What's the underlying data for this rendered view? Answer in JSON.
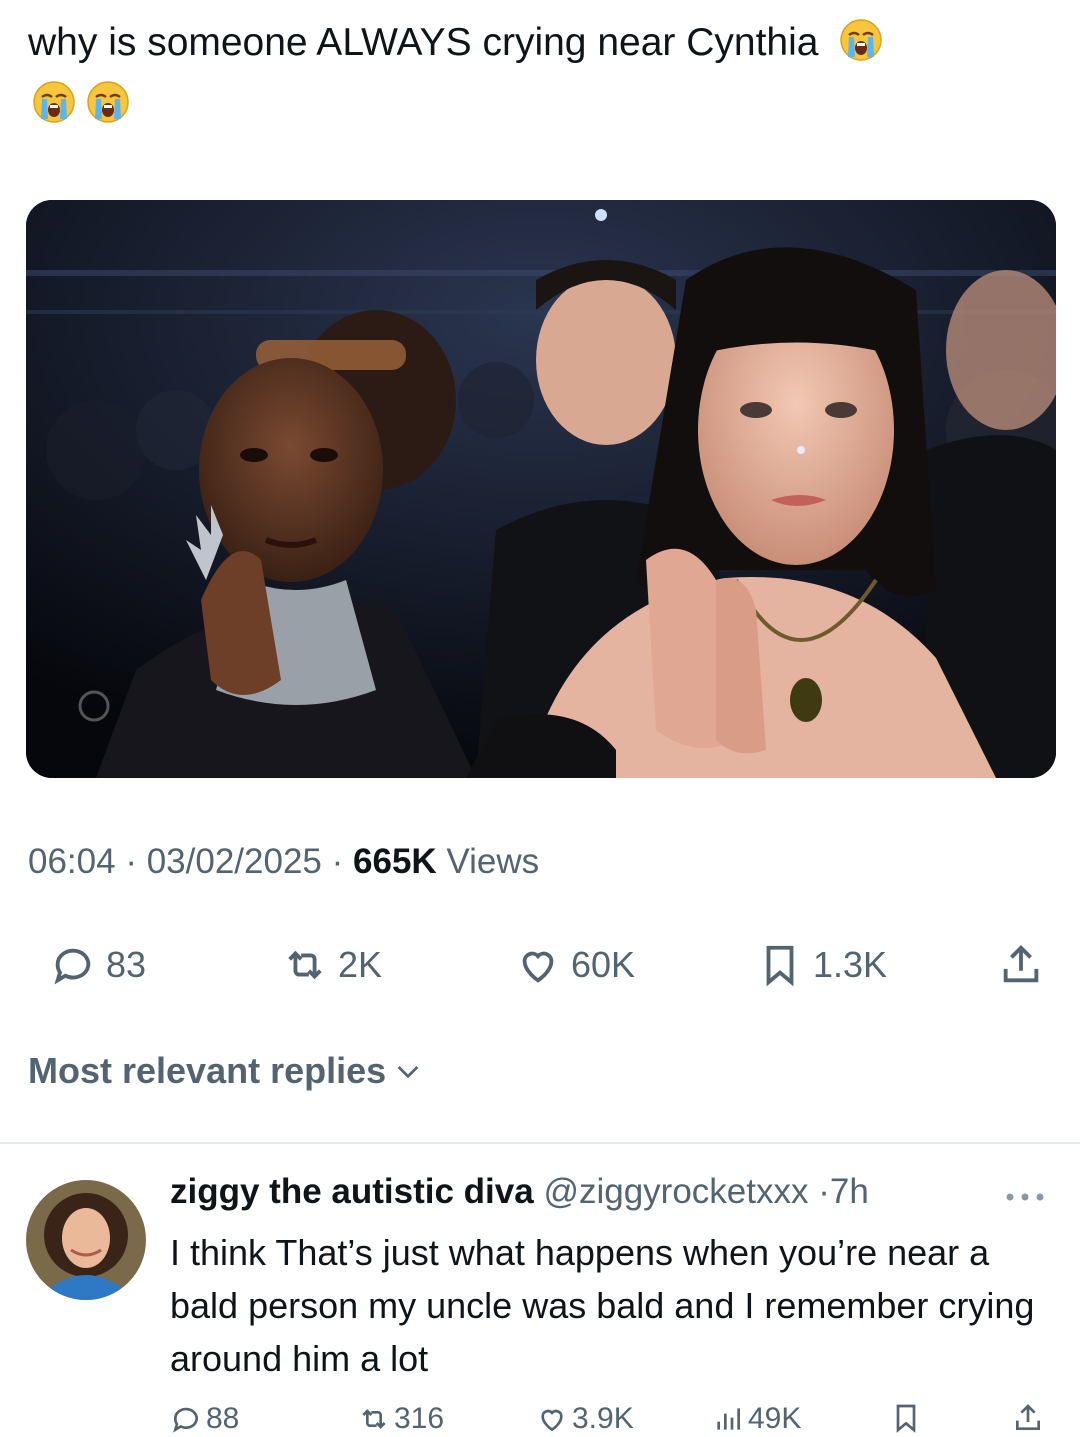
{
  "tweet": {
    "text": "why is someone ALWAYS crying near Cynthia",
    "emojis": [
      "loudly-crying-face",
      "loudly-crying-face",
      "loudly-crying-face"
    ],
    "time": "06:04",
    "date": "03/02/2025",
    "views_count": "665K",
    "views_label": "Views",
    "separator": "·",
    "media_description_icon": "photo"
  },
  "actions": {
    "replies": "83",
    "reposts": "2K",
    "likes": "60K",
    "bookmarks": "1.3K"
  },
  "sort": {
    "label": "Most relevant replies"
  },
  "reply": {
    "display_name": "ziggy the autistic diva",
    "handle": "@ziggyrocketxxx",
    "time": "7h",
    "text": "I think That’s just what happens when you’re near a bald person my uncle was bald and I remember crying around him a lot",
    "replies": "88",
    "reposts": "316",
    "likes": "3.9K",
    "views": "49K"
  },
  "colors": {
    "text_primary": "#0f1419",
    "text_secondary": "#536471",
    "divider": "#e6e9ec"
  }
}
